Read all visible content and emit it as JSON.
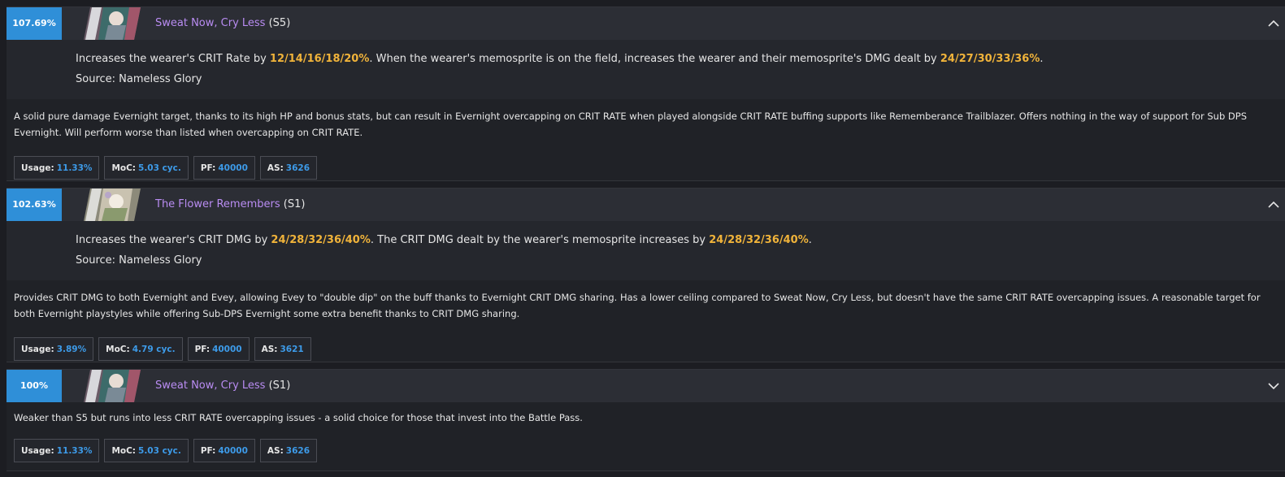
{
  "cards": [
    {
      "score": "107.69%",
      "name": "Sweat Now, Cry Less",
      "superimposition": "(S5)",
      "expanded": true,
      "effect": {
        "p1": "Increases the wearer's CRIT Rate by ",
        "v1": "12/14/16/18/20%",
        "p2": ". When the wearer's memosprite is on the field, increases the wearer and their memosprite's DMG dealt by ",
        "v2": "24/27/30/33/36%",
        "p3": "."
      },
      "source": "Source: Nameless Glory",
      "comment": "A solid pure damage Evernight target, thanks to its high HP and bonus stats, but can result in Evernight overcapping on CRIT RATE when played alongside CRIT RATE buffing supports like Rememberance Trailblazer. Offers nothing in the way of support for Sub DPS Evernight. Will perform worse than listed when overcapping on CRIT RATE.",
      "stats": {
        "usage_label": "Usage:",
        "usage": "11.33%",
        "moc_label": "MoC:",
        "moc": "5.03 cyc.",
        "pf_label": "PF:",
        "pf": "40000",
        "as_label": "AS:",
        "as": "3626"
      }
    },
    {
      "score": "102.63%",
      "name": "The Flower Remembers",
      "superimposition": "(S1)",
      "expanded": true,
      "effect": {
        "p1": "Increases the wearer's CRIT DMG by ",
        "v1": "24/28/32/36/40%",
        "p2": ". The CRIT DMG dealt by the wearer's memosprite increases by ",
        "v2": "24/28/32/36/40%",
        "p3": "."
      },
      "source": "Source: Nameless Glory",
      "comment": "Provides CRIT DMG to both Evernight and Evey, allowing Evey to \"double dip\" on the buff thanks to Evernight CRIT DMG sharing. Has a lower ceiling compared to Sweat Now, Cry Less, but doesn't have the same CRIT RATE overcapping issues. A reasonable target for both Evernight playstyles while offering Sub-DPS Evernight some extra benefit thanks to CRIT DMG sharing.",
      "stats": {
        "usage_label": "Usage:",
        "usage": "3.89%",
        "moc_label": "MoC:",
        "moc": "4.79 cyc.",
        "pf_label": "PF:",
        "pf": "40000",
        "as_label": "AS:",
        "as": "3621"
      }
    },
    {
      "score": "100%",
      "name": "Sweat Now, Cry Less",
      "superimposition": "(S1)",
      "expanded": false,
      "comment": "Weaker than S5 but runs into less CRIT RATE overcapping issues - a solid choice for those that invest into the Battle Pass.",
      "stats": {
        "usage_label": "Usage:",
        "usage": "11.33%",
        "moc_label": "MoC:",
        "moc": "5.03 cyc.",
        "pf_label": "PF:",
        "pf": "40000",
        "as_label": "AS:",
        "as": "3626"
      }
    }
  ],
  "colors": {
    "accent": "#2f8fd8",
    "name": "#b98cf2",
    "highlight": "#f0b33a",
    "stat_value": "#3d9be9"
  },
  "icons": {
    "expanded": "chevron-up-icon",
    "collapsed": "chevron-down-icon"
  }
}
